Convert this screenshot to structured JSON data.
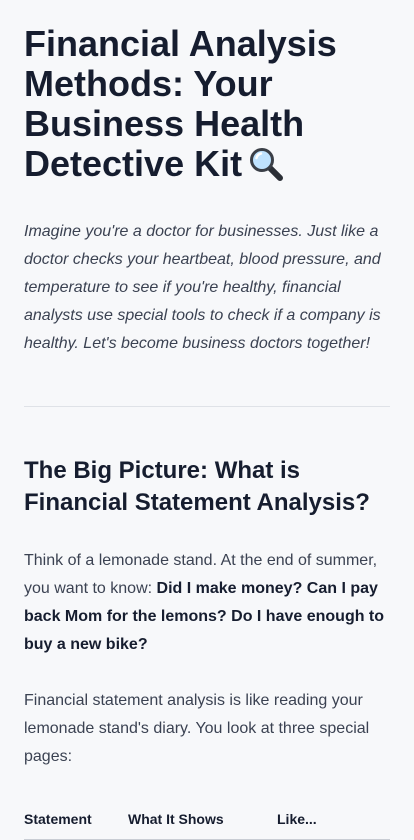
{
  "article": {
    "title": "Financial Analysis Methods: Your Business Health Detective Kit",
    "title_icon": "magnifying-glass-icon",
    "intro": "Imagine you're a doctor for businesses. Just like a doctor checks your heartbeat, blood pressure, and temperature to see if you're healthy, financial analysts use special tools to check if a company is healthy. Let's become business doctors together!"
  },
  "section1": {
    "heading": "The Big Picture: What is Financial Statement Analysis?",
    "p1_text": "Think of a lemonade stand. At the end of summer, you want to know: ",
    "p1_bold": "Did I make money? Can I pay back Mom for the lemons? Do I have enough to buy a new bike?",
    "p2": "Financial statement analysis is like reading your lemonade stand's diary. You look at three special pages:",
    "table": {
      "headers": [
        "Statement",
        "What It Shows",
        "Like..."
      ]
    }
  },
  "colors": {
    "background": "#f7f8fa",
    "heading": "#161d2f",
    "body_text": "#3b4252",
    "divider": "#dfe2e7"
  }
}
